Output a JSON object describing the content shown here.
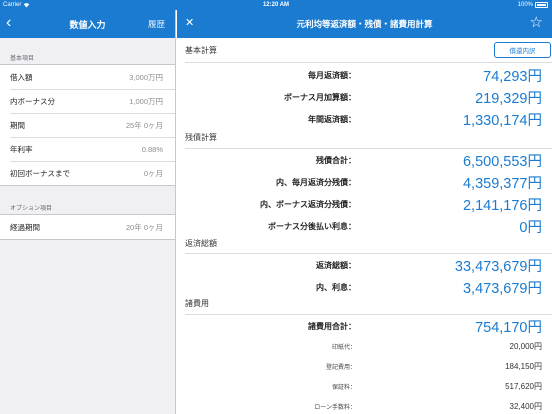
{
  "status_bar": {
    "carrier": "Carrier",
    "time": "12:20 AM",
    "battery": "100%"
  },
  "left_pane": {
    "title": "数値入力",
    "history_label": "履歴",
    "section_basic": "基本項目",
    "basic_rows": [
      {
        "label": "借入額",
        "value": "3,000万円"
      },
      {
        "label": "内ボーナス分",
        "value": "1,000万円"
      },
      {
        "label": "期間",
        "value": "25年 0ヶ月"
      },
      {
        "label": "年利率",
        "value": "0.88%"
      },
      {
        "label": "初回ボーナスまで",
        "value": "0ヶ月"
      }
    ],
    "section_option": "オプション項目",
    "option_rows": [
      {
        "label": "経過期間",
        "value": "20年 0ヶ月"
      }
    ]
  },
  "right_pane": {
    "title": "元利均等返済額・残債・諸費用計算",
    "repayment_button": "償還内訳",
    "sections": {
      "basic_calc": "基本計算",
      "remaining": "残債計算",
      "total_repay": "返済総額",
      "expenses": "諸費用"
    },
    "basic_calc_rows": [
      {
        "label": "毎月返済額：",
        "value": "74,293円"
      },
      {
        "label": "ボーナス月加算額：",
        "value": "219,329円"
      },
      {
        "label": "年間返済額：",
        "value": "1,330,174円"
      }
    ],
    "remaining_rows": [
      {
        "label": "残債合計：",
        "value": "6,500,553円"
      },
      {
        "label": "内、毎月返済分残債：",
        "value": "4,359,377円"
      },
      {
        "label": "内、ボーナス返済分残債：",
        "value": "2,141,176円"
      },
      {
        "label": "ボーナス分後払い利息：",
        "value": "0円"
      }
    ],
    "total_repay_rows": [
      {
        "label": "返済総額：",
        "value": "33,473,679円"
      },
      {
        "label": "内、利息：",
        "value": "3,473,679円"
      }
    ],
    "expenses_total": {
      "label": "諸費用合計：",
      "value": "754,170円"
    },
    "expense_rows": [
      {
        "label": "印紙代：",
        "value": "20,000円"
      },
      {
        "label": "登記費用：",
        "value": "184,150円"
      },
      {
        "label": "保証料：",
        "value": "517,620円"
      },
      {
        "label": "ローン手数料：",
        "value": "32,400円"
      }
    ]
  }
}
